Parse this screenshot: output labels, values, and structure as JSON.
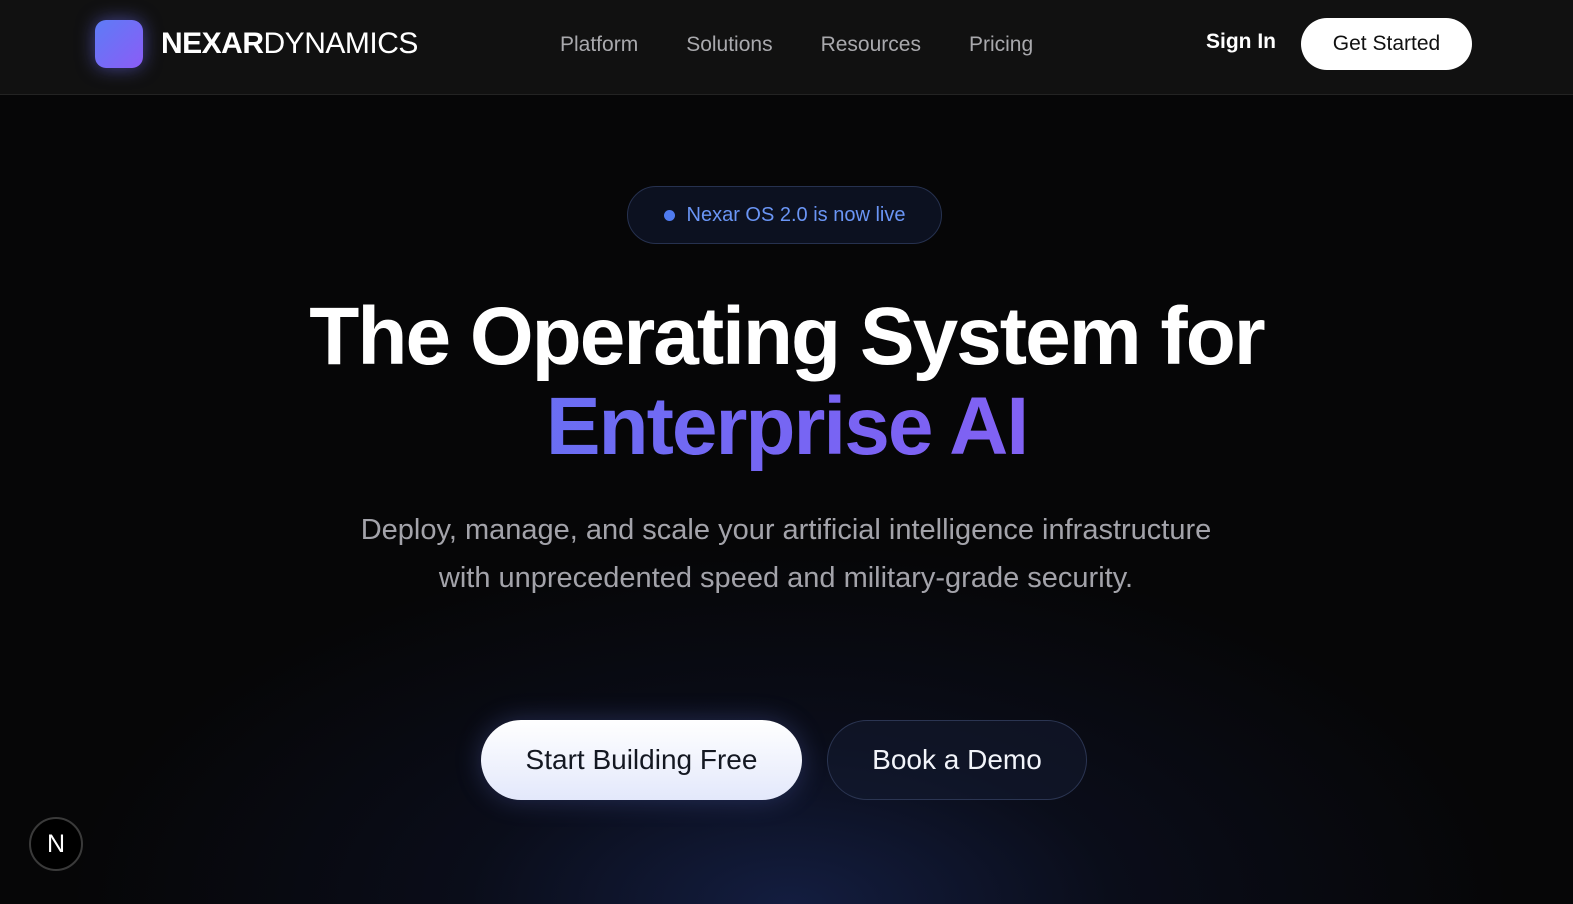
{
  "brand": {
    "name_bold": "NEXAR",
    "name_light": "DYNAMICS",
    "logo_gradient": [
      "#5d7cf6",
      "#8b5cf6"
    ]
  },
  "nav": {
    "items": [
      {
        "label": "Platform"
      },
      {
        "label": "Solutions"
      },
      {
        "label": "Resources"
      },
      {
        "label": "Pricing"
      }
    ],
    "signin_label": "Sign In",
    "get_started_label": "Get Started"
  },
  "hero": {
    "badge_text": "Nexar OS 2.0 is now live",
    "badge_dot_color": "#4f7bf0",
    "headline_line1": "The Operating System for",
    "headline_line2": "Enterprise AI",
    "subtitle": "Deploy, manage, and scale your artificial intelligence infrastructure with unprecedented speed and military-grade security.",
    "primary_cta": "Start Building Free",
    "secondary_cta": "Book a Demo"
  },
  "floating_badge": {
    "letter": "N",
    "icon": "nextjs-dev-indicator-icon"
  },
  "colors": {
    "accent_blue": "#4f80f2",
    "accent_purple": "#9a5cf5",
    "background": "#060607"
  }
}
